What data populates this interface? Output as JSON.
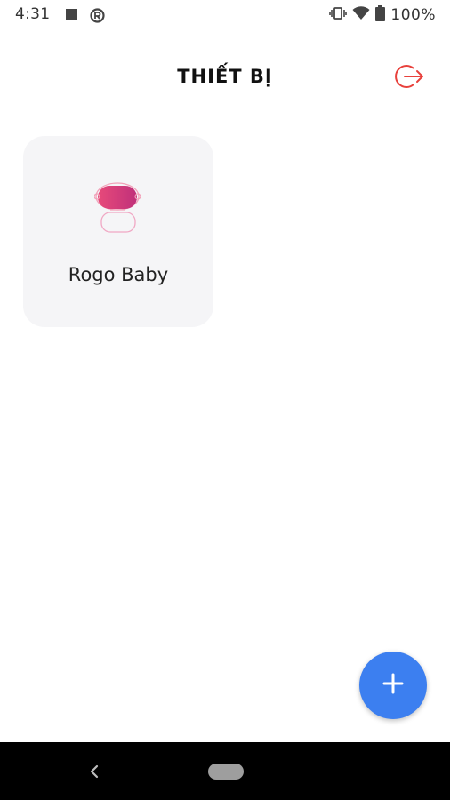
{
  "status_bar": {
    "time": "4:31",
    "battery_percent": "100%",
    "icons": [
      "stop-square-icon",
      "circle-r-icon",
      "vibrate-icon",
      "wifi-icon",
      "battery-icon"
    ]
  },
  "header": {
    "title": "THIẾT BỊ",
    "logout_icon": "logout-icon",
    "logout_color": "#e8413c"
  },
  "devices": [
    {
      "name": "Rogo Baby",
      "icon": "baby-monitor-icon"
    }
  ],
  "fab": {
    "icon": "plus-icon",
    "color": "#3c7ff0"
  },
  "nav_bar": {
    "icons": [
      "back-icon",
      "home-pill-icon"
    ]
  }
}
